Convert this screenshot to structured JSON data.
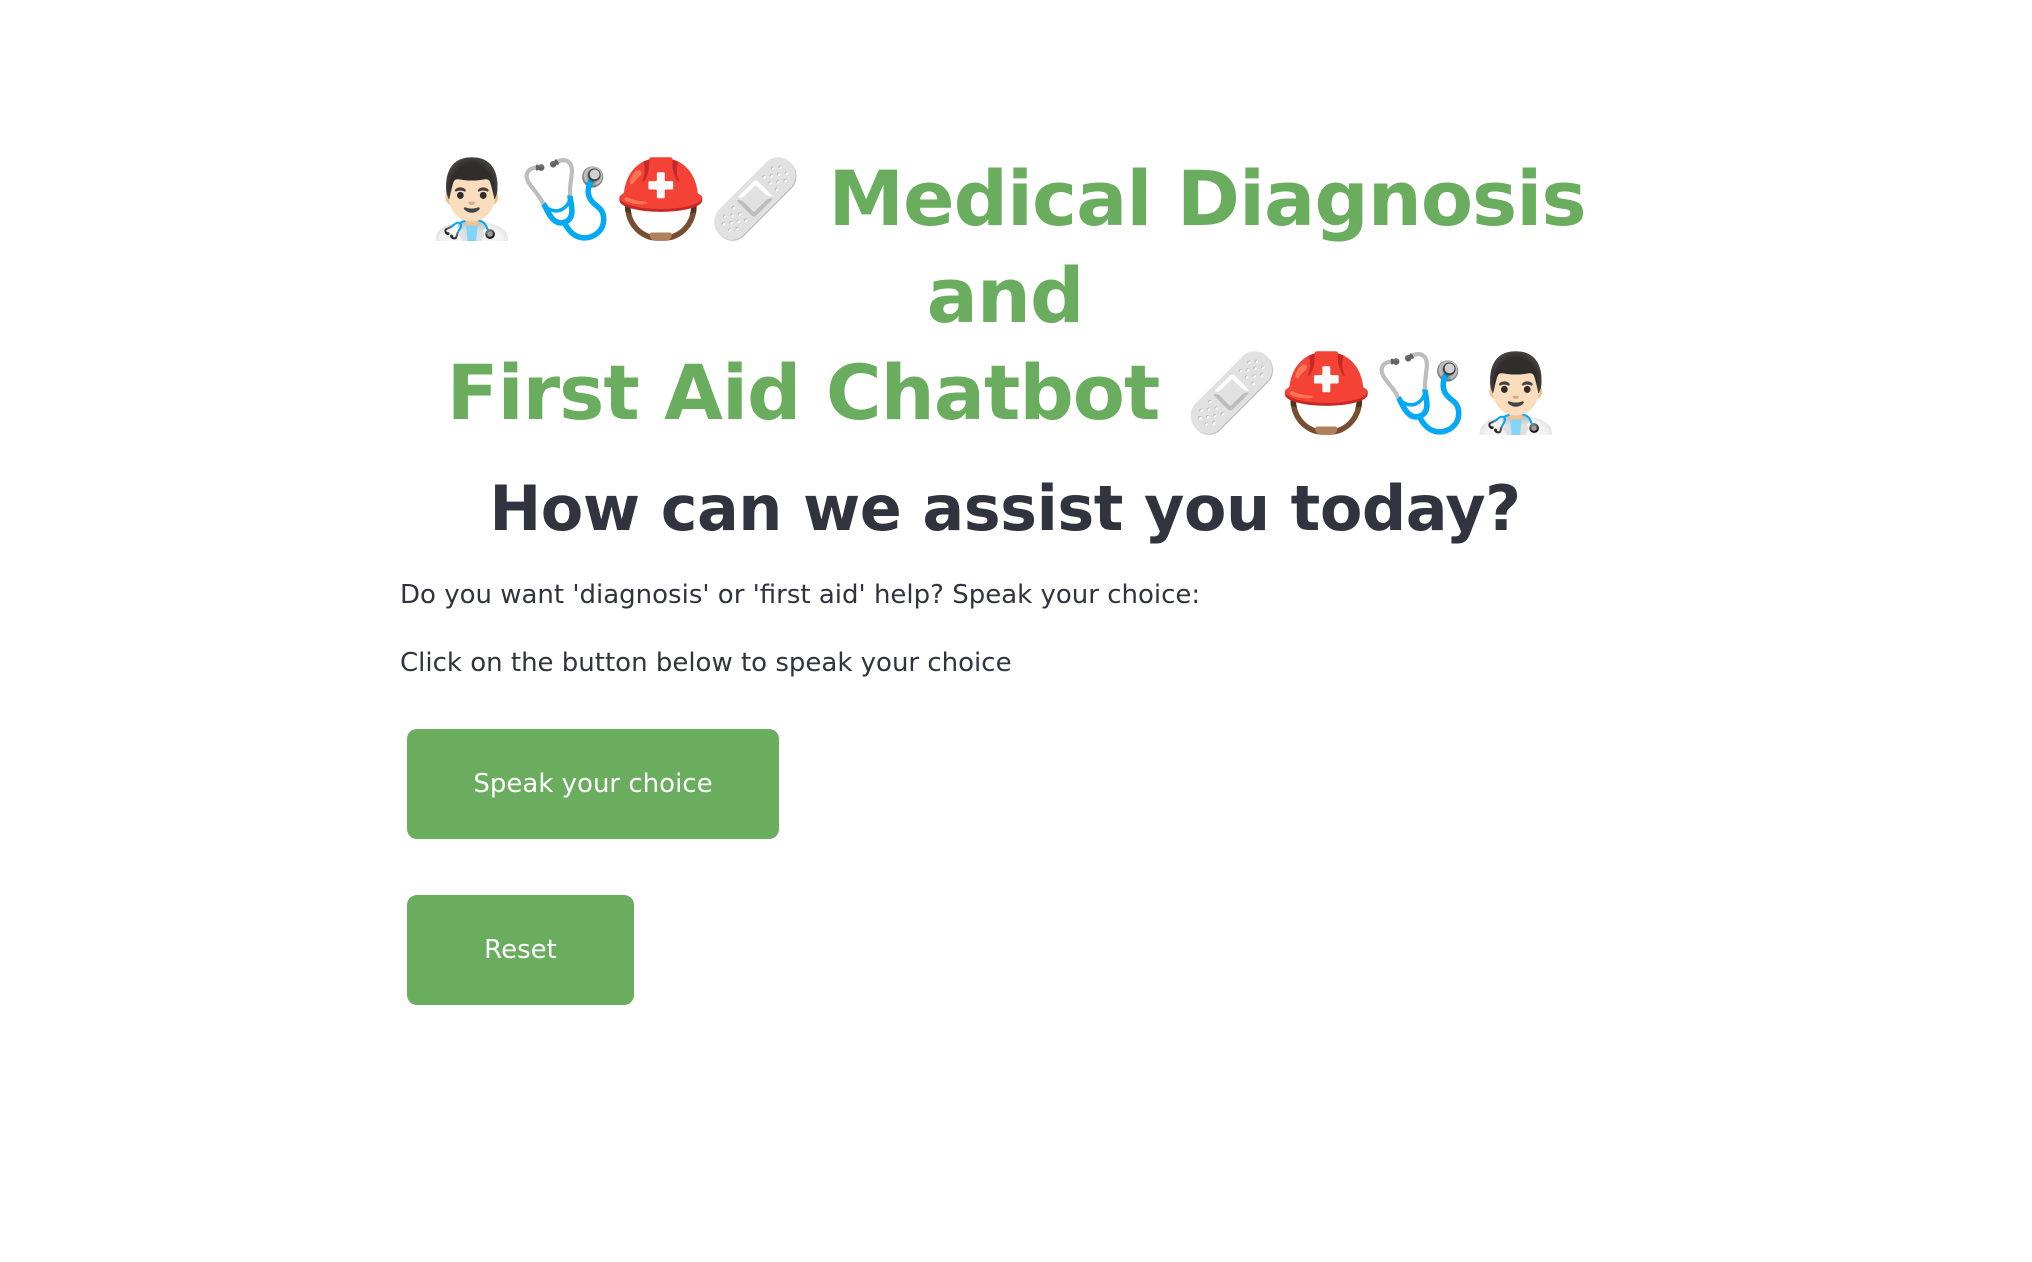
{
  "header": {
    "title_line1_emojis": "👨🏻‍⚕️🩺⛑️🩹",
    "title_line1_text": "Medical Diagnosis and",
    "title_line2_text": "First Aid Chatbot",
    "title_line2_emojis": "🩹⛑️🩺👨🏻‍⚕️"
  },
  "main": {
    "subtitle": "How can we assist you today?",
    "prompt_text": "Do you want 'diagnosis' or 'first aid' help? Speak your choice:",
    "instruction_text": "Click on the button below to speak your choice",
    "speak_button_label": "Speak your choice",
    "reset_button_label": "Reset"
  },
  "colors": {
    "accent": "#6aad5e",
    "text": "#31333f",
    "background": "#ffffff"
  }
}
